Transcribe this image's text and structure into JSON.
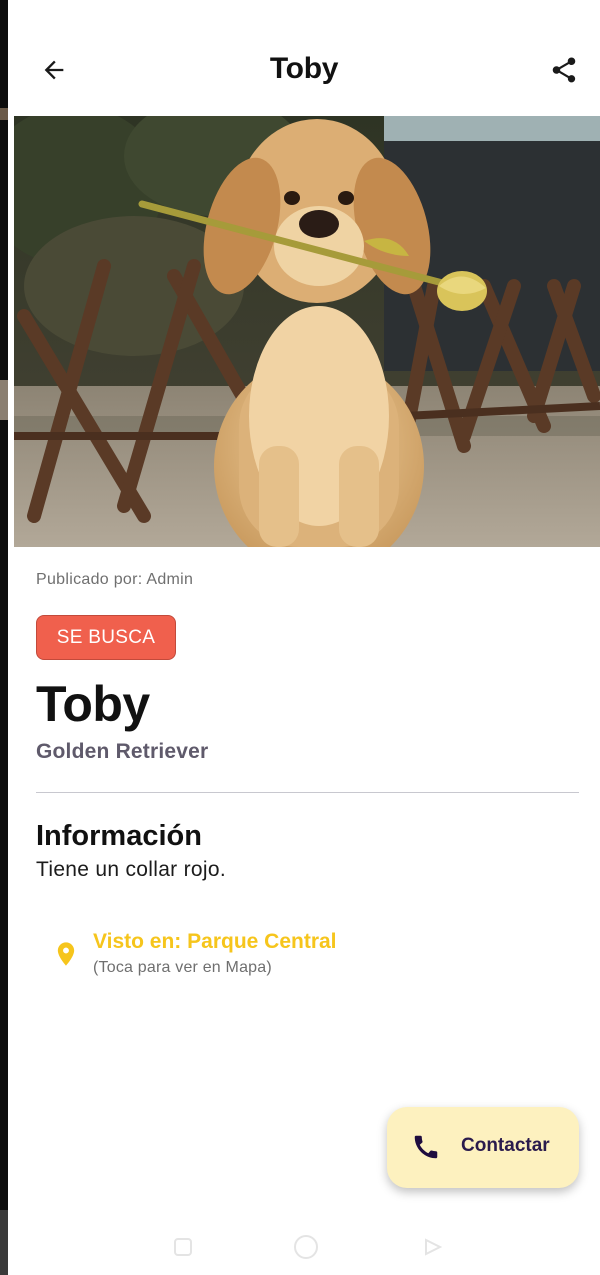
{
  "appbar": {
    "title": "Toby",
    "back_icon": "arrow-left-icon",
    "share_icon": "share-icon"
  },
  "photo": {
    "subject": "dog-photo"
  },
  "post": {
    "published_by": "Publicado por: Admin",
    "status_badge": "SE BUSCA",
    "pet_name": "Toby",
    "breed": "Golden Retriever"
  },
  "info": {
    "title": "Información",
    "text": "Tiene un collar rojo."
  },
  "location": {
    "icon": "map-pin-icon",
    "place": "Visto en: Parque Central",
    "hint": "(Toca para ver en Mapa)"
  },
  "fab": {
    "icon": "phone-icon",
    "label": "Contactar"
  },
  "colors": {
    "status_badge": "#f0604d",
    "location_accent": "#f6c51c",
    "fab_background": "#fdf1bf",
    "fab_text": "#2a1b4d",
    "breed_text": "#5f5a6b"
  }
}
